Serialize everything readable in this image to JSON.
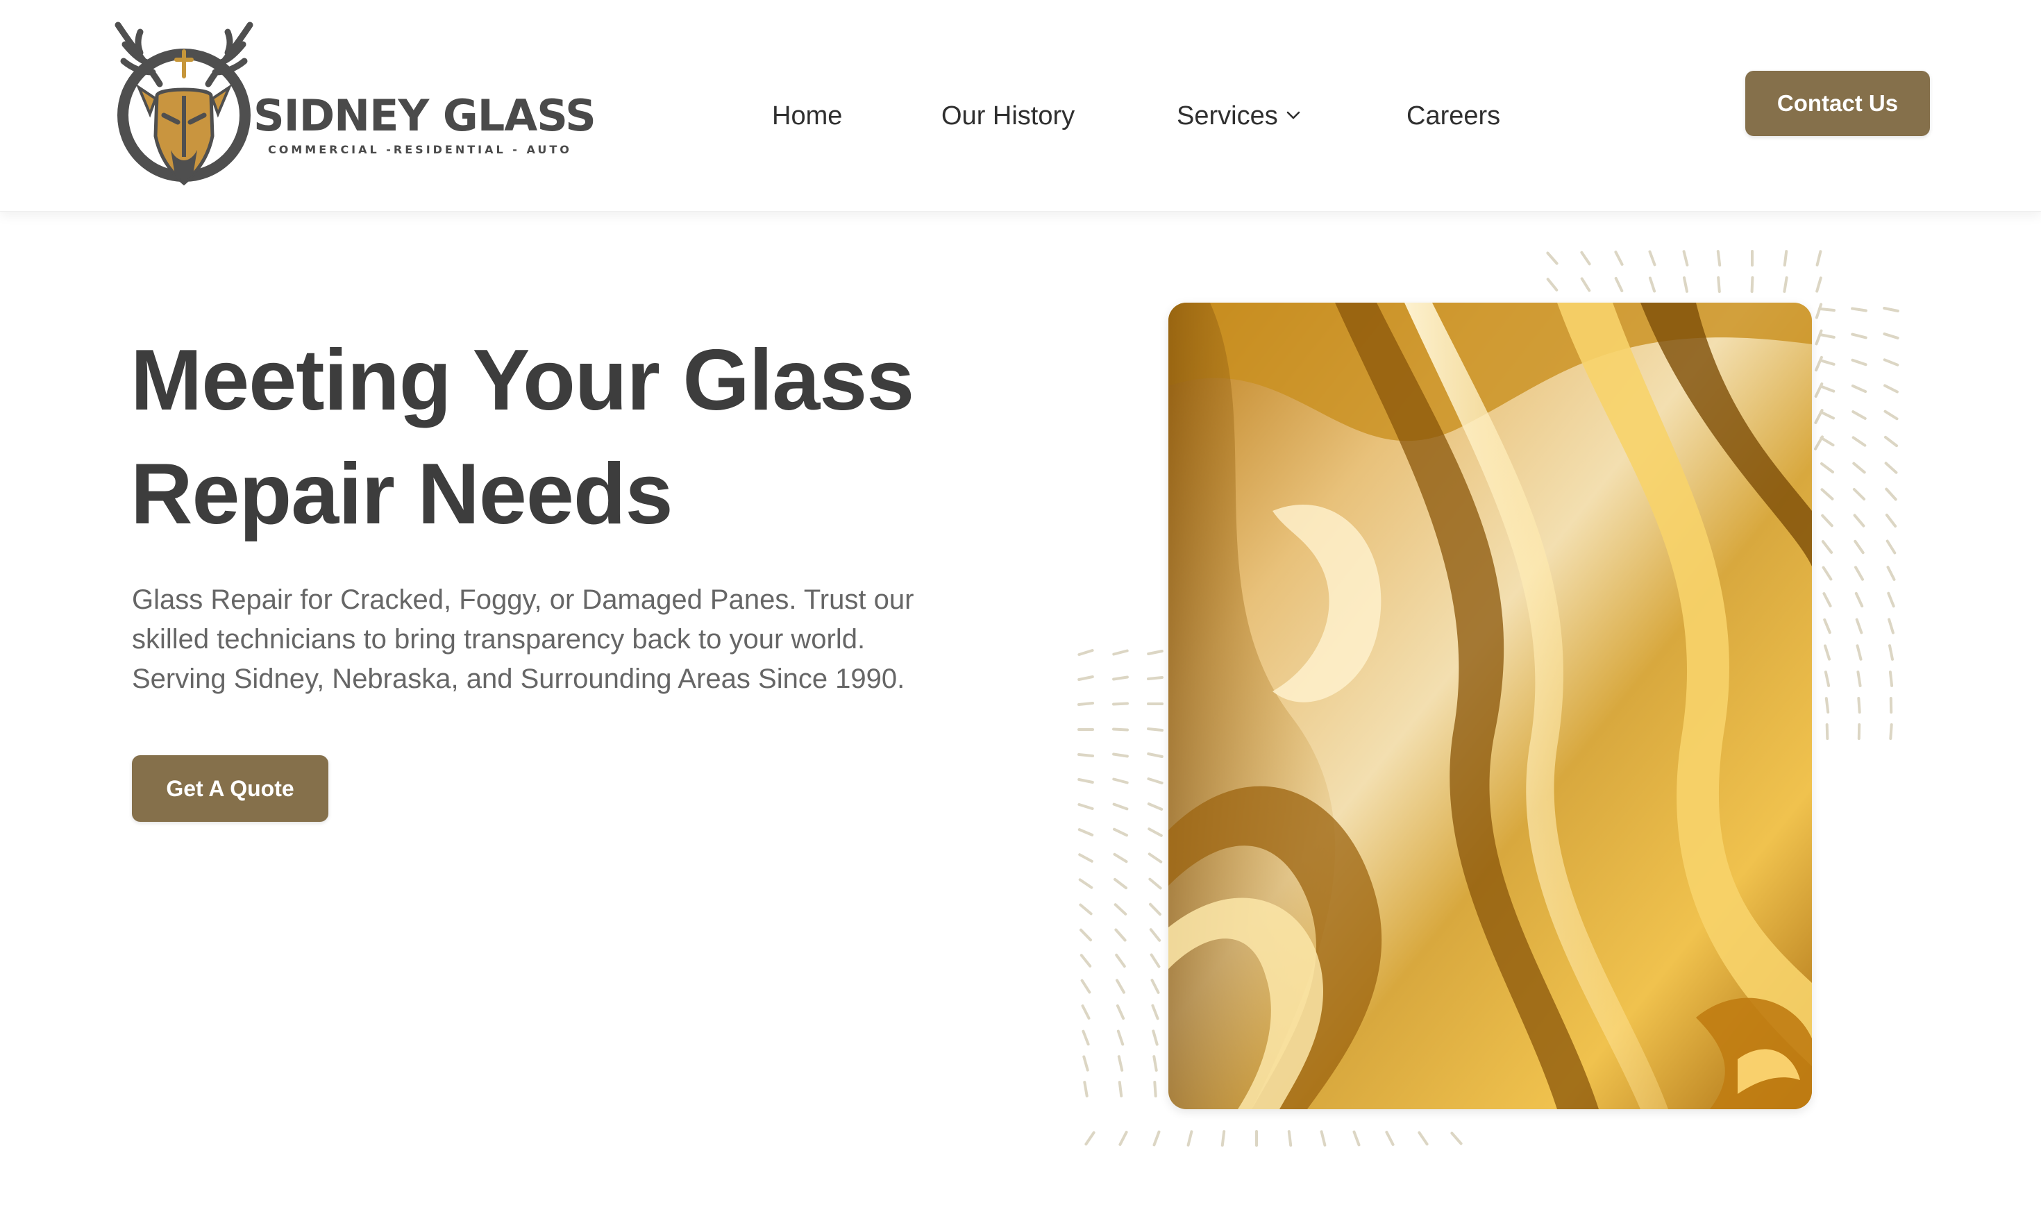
{
  "brand": {
    "name": "SIDNEY GLASS",
    "tagline": "COMMERCIAL -RESIDENTIAL - AUTO",
    "accent_color": "#85704b"
  },
  "nav": {
    "home": "Home",
    "history": "Our History",
    "services": "Services",
    "careers": "Careers",
    "services_icon": "chevron-down-icon"
  },
  "header": {
    "contact_label": "Contact Us"
  },
  "hero": {
    "title_line1": "Meeting Your Glass",
    "title_line2": "Repair Needs",
    "desc_line1": "Glass Repair for Cracked, Foggy, or Damaged Panes. Trust our",
    "desc_line2": "skilled technicians to bring transparency back to your world.",
    "desc_line3": "Serving Sidney, Nebraska, and Surrounding Areas Since 1990.",
    "quote_label": "Get A Quote"
  }
}
